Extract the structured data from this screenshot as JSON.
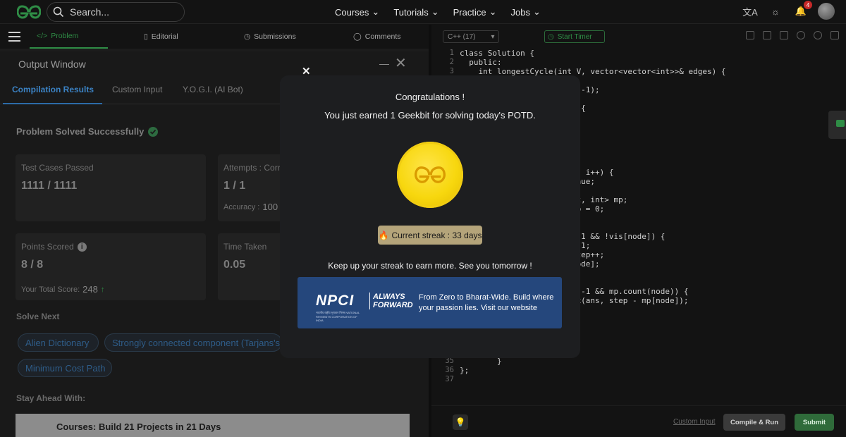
{
  "nav": {
    "search_placeholder": "Search...",
    "links": [
      "Courses",
      "Tutorials",
      "Practice",
      "Jobs"
    ],
    "notification_count": "4"
  },
  "problem_tabs": [
    "Problem",
    "Editorial",
    "Submissions",
    "Comments"
  ],
  "output_window": {
    "title": "Output Window",
    "tabs": [
      "Compilation Results",
      "Custom Input",
      "Y.O.G.I. (AI Bot)"
    ],
    "solved_text": "Problem Solved Successfully",
    "cards": {
      "test_cases_label": "Test Cases Passed",
      "test_cases_value": "1111 / 1111",
      "attempts_label": "Attempts : Corr",
      "attempts_value": "1 / 1",
      "accuracy_label": "Accuracy :",
      "accuracy_value": "100",
      "points_label": "Points Scored",
      "points_value": "8 / 8",
      "total_score_label": "Your Total Score:",
      "total_score_value": "248",
      "time_label": "Time Taken",
      "time_value": "0.05"
    },
    "solve_next_title": "Solve Next",
    "solve_next": [
      "Alien Dictionary",
      "Strongly connected component (Tarjans's",
      "Minimum Cost Path"
    ],
    "stay_ahead_title": "Stay Ahead With:",
    "ad_strip_text": "Courses: Build 21 Projects in 21 Days"
  },
  "editor": {
    "language": "C++ (17)",
    "timer_label": "Start Timer",
    "lines": [
      {
        "n": "1",
        "text": "class Solution {"
      },
      {
        "n": "2",
        "text": "  public:"
      },
      {
        "n": "3",
        "text": "    int longestCycle(int V, vector<vector<int>>& edges) {"
      },
      {
        "n": "",
        "text": "                          -1);"
      },
      {
        "n": "",
        "text": "                        ) {"
      },
      {
        "n": "",
        "text": "                        ];"
      },
      {
        "n": "",
        "text": "                        );"
      },
      {
        "n": "",
        "text": "                        V; i++) {"
      },
      {
        "n": "",
        "text": "                        inue;"
      },
      {
        "n": "",
        "text": "                        nt, int> mp;"
      },
      {
        "n": "",
        "text": "                        ep = 0;"
      },
      {
        "n": "",
        "text": "                          1 && !vis[node]) {"
      },
      {
        "n": "",
        "text": "                          1;"
      },
      {
        "n": "",
        "text": "                        step++;"
      },
      {
        "n": "",
        "text": "                        node];"
      },
      {
        "n": "",
        "text": "                          -1 && mp.count(node)) {"
      },
      {
        "n": "",
        "text": "                        ax(ans, step - mp[node]);"
      },
      {
        "n": "35",
        "text": "        }"
      },
      {
        "n": "36",
        "text": "};"
      },
      {
        "n": "37",
        "text": ""
      }
    ],
    "custom_input_link": "Custom Input",
    "compile_run": "Compile & Run",
    "submit": "Submit"
  },
  "modal": {
    "title": "Congratulations !",
    "subtitle": "You just earned 1 Geekbit for solving today's POTD.",
    "streak": "Current streak : 33 days",
    "keep": "Keep up your streak to earn more. See you tomorrow !",
    "ad_brand": "NPCI",
    "ad_brand_sub": "भारतीय राष्ट्रीय भुगतान निगम NATIONAL PAYMENTS CORPORATION OF INDIA",
    "ad_tagline_1": "ALWAYS",
    "ad_tagline_2": "FORWARD",
    "ad_text": "From Zero to Bharat-Wide. Build where your passion lies. Visit our website"
  },
  "colors": {
    "accent_green": "#2f8d46",
    "link_blue": "#3b82c4",
    "coin_gold": "#f7d70e",
    "ad_blue": "#25477c"
  }
}
